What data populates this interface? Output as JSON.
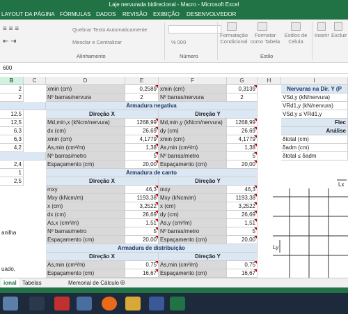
{
  "window": {
    "title": "Laje nervurada bidirecional - Macro - Microsoft Excel"
  },
  "ribbon_tabs": [
    "LAYOUT DA PÁGINA",
    "FÓRMULAS",
    "DADOS",
    "REVISÃO",
    "EXIBIÇÃO",
    "DESENVOLVEDOR"
  ],
  "ribbon": {
    "wrap_text": "Quebrar Texto Automaticamente",
    "merge_center": "Mesclar e Centralizar",
    "alignment_group": "Alinhamento",
    "number_group": "Número",
    "styles_group": "Estilo",
    "conditional_format": "Formatação Condicional",
    "format_table": "Formatar como Tabela",
    "cell_styles": "Estilos de Célula",
    "insert": "Inserir",
    "delete": "Excluir",
    "number_format_hint": "%  000"
  },
  "formula_bar": {
    "value": "600"
  },
  "columns": [
    "B",
    "C",
    "D",
    "E",
    "F",
    "G",
    "H",
    "I"
  ],
  "left_col_values": [
    "2",
    "2",
    "",
    "12,5",
    "12,5",
    "6,3",
    "6,3",
    "4,2",
    "",
    "2,4",
    "1",
    "2,5"
  ],
  "left_col_text": [
    "anilha",
    "uado,"
  ],
  "rows": {
    "r1": {
      "d": "xmin (cm)",
      "e": "0,2589",
      "f": "xmin (cm)",
      "g": "0,3139"
    },
    "r2": {
      "d": "Nº barras/nervura",
      "e": "2",
      "f": "Nº barras/nervura",
      "g": "2"
    },
    "sec_neg": "Armadura negativa",
    "dir_x": "Direção X",
    "dir_y": "Direção Y",
    "neg": [
      {
        "d": "Md,min,x (kNcm/nervura)",
        "e": "1268,99",
        "f": "Md,min,y (kNcm/nervura)",
        "g": "1268,99"
      },
      {
        "d": "dx (cm)",
        "e": "26,69",
        "f": "dy (cm)",
        "g": "26,69"
      },
      {
        "d": "xmin (cm)",
        "e": "4,1779",
        "f": "xmin (cm)",
        "g": "4,1779"
      },
      {
        "d": "As,min (cm²/m)",
        "e": "1,38",
        "f": "As,min (cm²/m)",
        "g": "1,38"
      },
      {
        "d": "Nº barras/metro",
        "e": "5",
        "f": "Nº barras/metro",
        "g": "5"
      },
      {
        "d": "Espaçamento (cm)",
        "e": "20,00",
        "f": "Espaçamento (cm)",
        "g": "20,00"
      }
    ],
    "sec_canto": "Armadura de canto",
    "canto": [
      {
        "d": "mxy",
        "e": "46,3",
        "f": "mxy",
        "g": "46,3"
      },
      {
        "d": "Mxy (kNcm/m)",
        "e": "1193,38",
        "f": "Mxy (kNcm/m)",
        "g": "1193,38"
      },
      {
        "d": "x (cm)",
        "e": "3,2522",
        "f": "x (cm)",
        "g": "3,2522"
      },
      {
        "d": "dx (cm)",
        "e": "26,69",
        "f": "dy (cm)",
        "g": "26,69"
      },
      {
        "d": "As,x (cm²/m)",
        "e": "1,51",
        "f": "As,y (cm²/m)",
        "g": "1,51"
      },
      {
        "d": "Nº barras/metro",
        "e": "5",
        "f": "Nº barras/metro",
        "g": "5"
      },
      {
        "d": "Espaçamento (cm)",
        "e": "20,00",
        "f": "Espaçamento (cm)",
        "g": "20,00"
      }
    ],
    "sec_dist": "Armadura de distribuição",
    "dist": [
      {
        "d": "As,min (cm²/m)",
        "e": "0,75",
        "f": "As,min (cm²/m)",
        "g": "0,75"
      },
      {
        "d": "Espaçamento (cm)",
        "e": "16,67",
        "f": "Espaçamento (cm)",
        "g": "16,67"
      }
    ]
  },
  "right_panel": {
    "title": "Nervuras na Dir. Y (P",
    "items": [
      "VSd,y (kN/nervura)",
      "VRd1,y (kN/nervura)",
      "VSd,y ≤ VRd1,y"
    ],
    "flecha": "Flec",
    "analise": "Análise",
    "items2": [
      "δtotal (cm)",
      "δadm (cm)",
      "δtotal ≤ δadm"
    ]
  },
  "drawing": {
    "lx": "Lx",
    "ly": "Ly"
  },
  "sheets": [
    "ional",
    "Tabelas",
    "Memorial de Cálculo"
  ]
}
